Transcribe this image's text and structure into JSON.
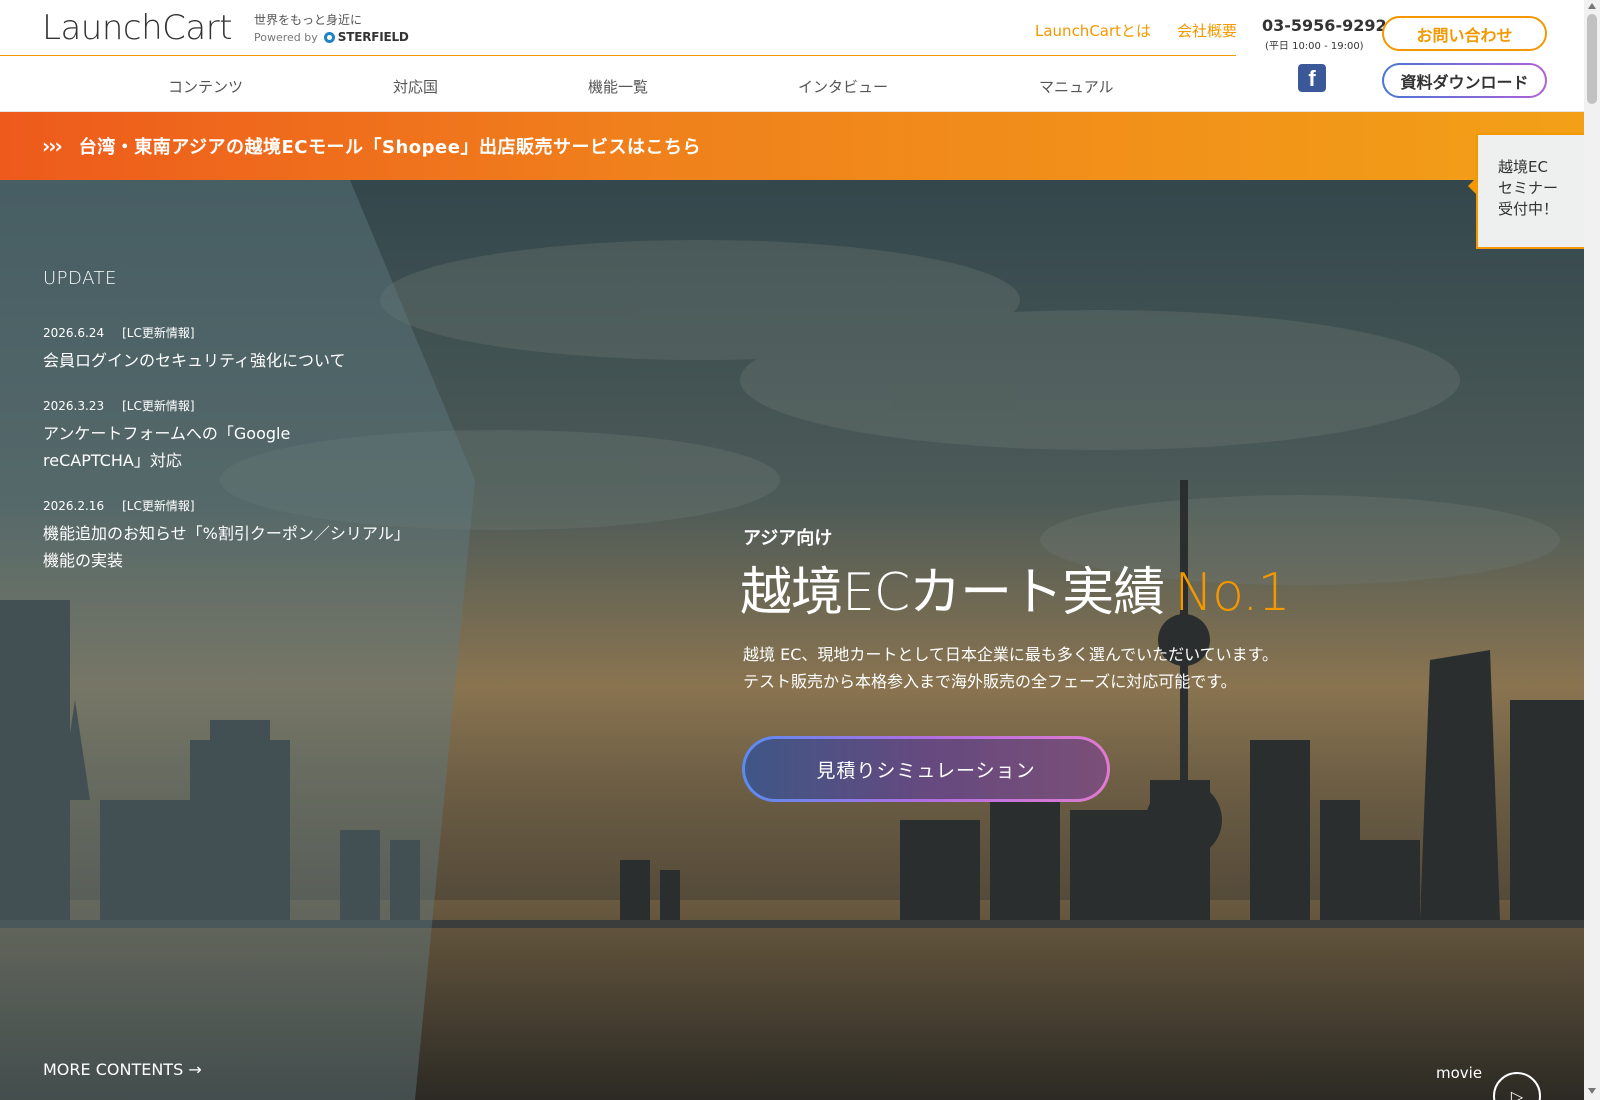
{
  "header": {
    "logo": "LaunchCart",
    "tagline": "世界をもっと身近に",
    "powered_by": "Powered by",
    "partner": "STERFIELD",
    "links": {
      "about": "LaunchCartとは",
      "company": "会社概要"
    },
    "phone": "03-5956-9292",
    "phone_hours": "(平日 10:00 - 19:00)",
    "contact_label": "お問い合わせ",
    "download_label": "資料ダウンロード",
    "facebook_glyph": "f",
    "nav": [
      "コンテンツ",
      "対応国",
      "機能一覧",
      "インタビュー",
      "マニュアル"
    ]
  },
  "banner": {
    "chevrons": "›››",
    "text": "台湾・東南アジアの越境ECモール「Shopee」出店販売サービスはこちら"
  },
  "seminar": {
    "lines": [
      "越境EC",
      "セミナー",
      "受付中！"
    ]
  },
  "update": {
    "title": "UPDATE",
    "items": [
      {
        "date": "2026.6.24",
        "category": "[LC更新情報]",
        "title": "会員ログインのセキュリティ強化について"
      },
      {
        "date": "2026.3.23",
        "category": "[LC更新情報]",
        "title": "アンケートフォームへの「Google reCAPTCHA」対応"
      },
      {
        "date": "2026.2.16",
        "category": "[LC更新情報]",
        "title": "機能追加のお知らせ「%割引クーポン／シリアル」機能の実装"
      }
    ],
    "more": "MORE CONTENTS →"
  },
  "hero": {
    "sub_head": "アジア向け",
    "main_head": "越境ECカート実績",
    "highlight": "No.1",
    "desc_line1": "越境 EC、現地カートとして日本企業に最も多く選んでいただいています。",
    "desc_line2": "テスト販売から本格参入まで海外販売の全フェーズに対応可能です。",
    "cta": "見積りシミュレーション",
    "movie": "movie",
    "play_glyph": "▷"
  },
  "colors": {
    "accent": "#f39800",
    "banner_start": "#ee5a1c",
    "banner_end": "#f3a017",
    "facebook": "#3b5998"
  }
}
